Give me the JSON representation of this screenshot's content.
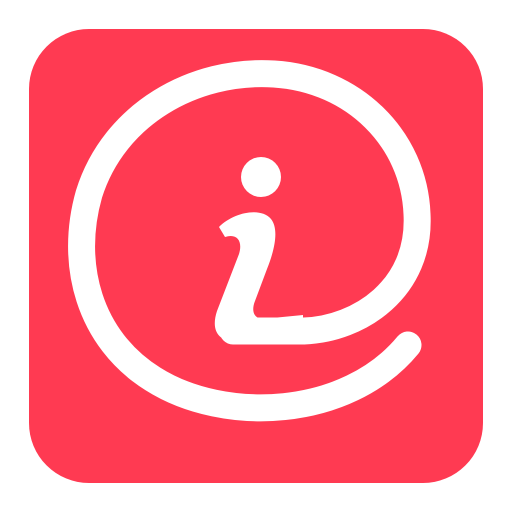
{
  "app_icon": {
    "icon": "info-at-icon",
    "colors": {
      "background": "#FF3A52",
      "glyph": "#FFFFFF"
    }
  }
}
